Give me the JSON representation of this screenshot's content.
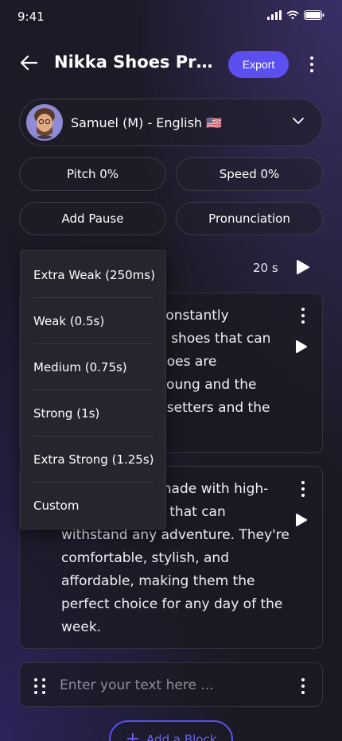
{
  "status": {
    "time": "9:41"
  },
  "header": {
    "title": "Nikka Shoes Pro...",
    "export_label": "Export"
  },
  "voice": {
    "label": "Samuel (M) - English 🇺🇸"
  },
  "controls": {
    "pitch_label": "Pitch  0%",
    "speed_label": "Speed  0%",
    "add_pause_label": "Add Pause",
    "pronunciation_label": "Pronunciation"
  },
  "player": {
    "duration": "20 s"
  },
  "blocks": [
    {
      "lines": [
        "constantly",
        "d shoes that can",
        "hoes are",
        " young and the",
        "dsetters and the"
      ]
    },
    {
      "lines": [
        "made with high-",
        "s that can",
        "withstand any adventure. They're",
        "comfortable, stylish, and",
        "affordable, making them the",
        "perfect choice for any day of the",
        "week."
      ]
    }
  ],
  "input": {
    "placeholder": "Enter your text here ..."
  },
  "add_block_label": "Add a Block",
  "pause_menu": {
    "items": [
      "Extra Weak (250ms)",
      "Weak (0.5s)",
      "Medium (0.75s)",
      "Strong (1s)",
      "Extra Strong (1.25s)",
      "Custom"
    ]
  },
  "colors": {
    "accent": "#5b4ff0",
    "background": "#1b1a26"
  }
}
